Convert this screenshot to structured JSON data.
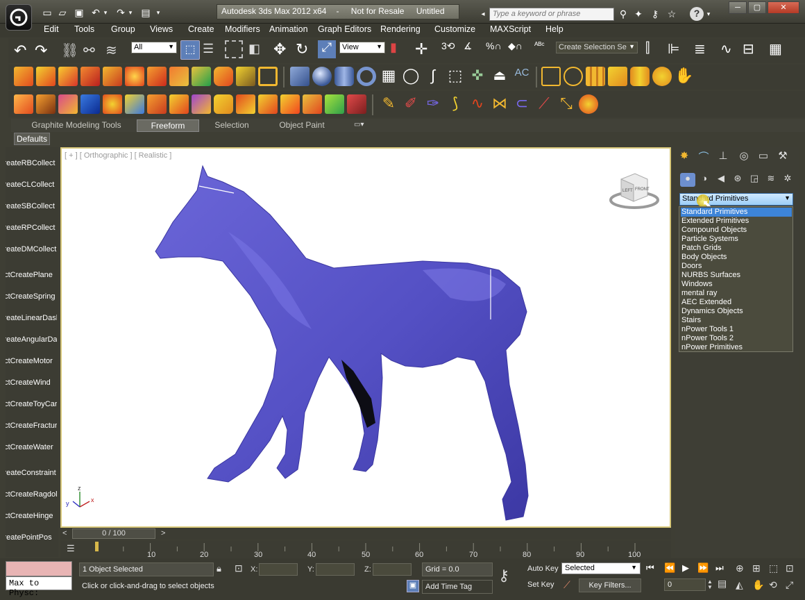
{
  "title_bar": {
    "app_title": "Autodesk 3ds Max  2012 x64",
    "license": "Not for Resale",
    "document": "Untitled",
    "search_placeholder": "Type a keyword or phrase"
  },
  "menu": [
    "Edit",
    "Tools",
    "Group",
    "Views",
    "Create",
    "Modifiers",
    "Animation",
    "Graph Editors",
    "Rendering",
    "Customize",
    "MAXScript",
    "Help"
  ],
  "toolbar": {
    "filter_value": "All",
    "refcoord_value": "View",
    "selection_set_placeholder": "Create Selection Se"
  },
  "ribbon": {
    "tabs": [
      "Graphite Modeling Tools",
      "Freeform",
      "Selection",
      "Object Paint"
    ],
    "active_tab": "Freeform",
    "defaults_label": "Defaults"
  },
  "left_panel": {
    "items": [
      "createRBCollect",
      "createCLCollect",
      "createSBCollect",
      "createRPCollect",
      "createDMCollect",
      "actCreatePlane",
      "actCreateSpring",
      "createLinearDash",
      "createAngularDash",
      "actCreateMotor",
      "actCreateWind",
      "actCreateToyCar",
      "actCreateFracture",
      "actCreateWater",
      "createConstraint",
      "actCreateRagdoll",
      "actCreateHinge",
      "createPointPos"
    ]
  },
  "viewport": {
    "label": "[ + ] [ Orthographic ] [ Realistic ]",
    "viewcube_faces": [
      "LEFT",
      "FRONT"
    ],
    "axis_labels": {
      "x": "x",
      "y": "y",
      "z": "z"
    },
    "model_color": "#5a55c8"
  },
  "command_panel": {
    "dropdown_value": "Standard Primitives",
    "options": [
      "Standard Primitives",
      "Extended Primitives",
      "Compound Objects",
      "Particle Systems",
      "Patch Grids",
      "Body Objects",
      "Doors",
      "NURBS Surfaces",
      "Windows",
      "mental ray",
      "AEC Extended",
      "Dynamics Objects",
      "Stairs",
      "nPower Tools 1",
      "nPower Tools 2",
      "nPower Primitives"
    ],
    "selected_index": 0
  },
  "timeline": {
    "position": "0 / 100",
    "current_frame": 0,
    "total_frames": 100,
    "ticks": [
      "10",
      "20",
      "30",
      "40",
      "50",
      "60",
      "70",
      "80",
      "90",
      "100"
    ]
  },
  "status": {
    "maxscript_text": "Max to Physc:",
    "selection_info": "1 Object Selected",
    "prompt": "Click or click-and-drag to select objects",
    "x_label": "X:",
    "y_label": "Y:",
    "z_label": "Z:",
    "grid": "Grid = 0.0",
    "add_time_tag": "Add Time Tag",
    "auto_key": "Auto Key",
    "set_key": "Set Key",
    "key_mode": "Selected",
    "key_filters": "Key Filters...",
    "frame_value": "0"
  }
}
